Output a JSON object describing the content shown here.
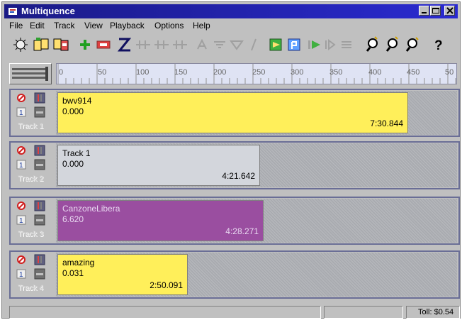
{
  "window": {
    "title": "Multiquence",
    "accent": "#1a1a86"
  },
  "menu": {
    "file": "File",
    "edit": "Edit",
    "track": "Track",
    "view": "View",
    "playback": "Playback",
    "options": "Options",
    "help": "Help"
  },
  "toolbar": {
    "icons": [
      "new-icon",
      "open-icon",
      "save-icon",
      "add-track-icon",
      "remove-track-icon",
      "zoom-z-icon",
      "align-1-icon",
      "align-2-icon",
      "align-3-icon",
      "tool-a-icon",
      "tool-b-icon",
      "tool-c-icon",
      "tool-d-icon",
      "insert-icon",
      "record-icon",
      "play-icon",
      "step-icon",
      "stop-icon",
      "zoom-in-icon",
      "zoom-out-icon",
      "zoom-fit-icon",
      "help-icon"
    ]
  },
  "ruler": {
    "ticks": [
      "0",
      "50",
      "100",
      "150",
      "200",
      "250",
      "300",
      "350",
      "400",
      "450",
      "50"
    ]
  },
  "tracks": [
    {
      "name": "Track 1",
      "clip_name": "bwv914",
      "clip_start": "0.000",
      "clip_duration": "7:30.844",
      "clip_color": "#ffef5a",
      "clip_fraction": 0.875
    },
    {
      "name": "Track 2",
      "clip_name": "Track 1",
      "clip_start": "0.000",
      "clip_duration": "4:21.642",
      "clip_color": "#d3d6dc",
      "clip_fraction": 0.505
    },
    {
      "name": "Track 3",
      "clip_name": "CanzoneLibera",
      "clip_start": "6.620",
      "clip_duration": "4:28.271",
      "clip_color": "#9a4ea0",
      "clip_fraction": 0.515
    },
    {
      "name": "Track 4",
      "clip_name": "amazing",
      "clip_start": "0.031",
      "clip_duration": "2:50.091",
      "clip_color": "#ffef5a",
      "clip_fraction": 0.325
    }
  ],
  "status": {
    "toll": "Toll: $0.54"
  }
}
